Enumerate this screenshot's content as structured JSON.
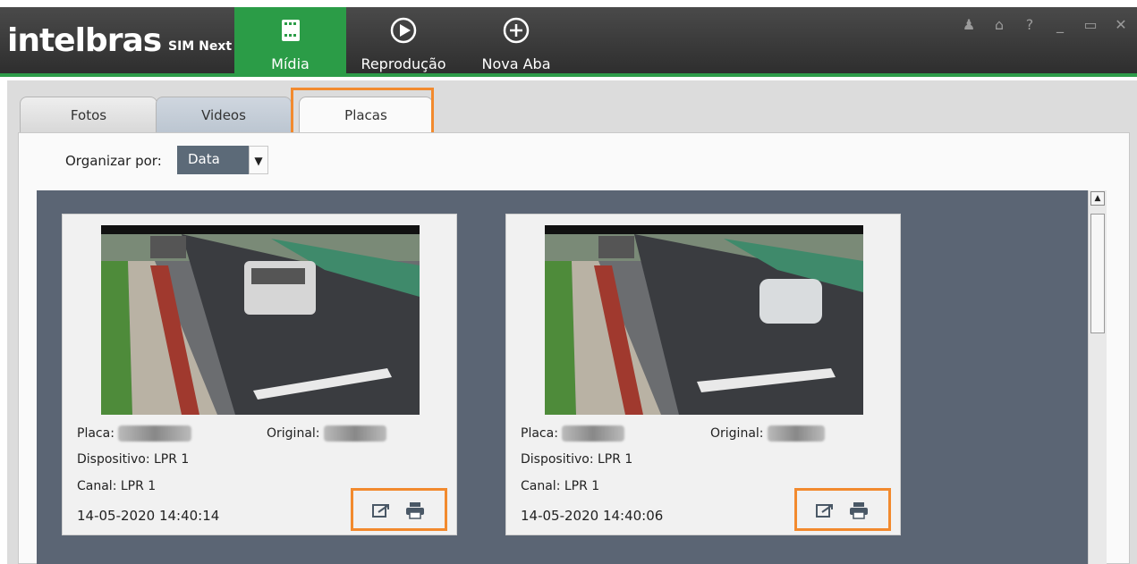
{
  "brand": {
    "name": "intelbras",
    "product": "SIM Next"
  },
  "nav": [
    {
      "label": "Mídia",
      "icon": "film-icon"
    },
    {
      "label": "Reprodução",
      "icon": "play-icon"
    },
    {
      "label": "Nova Aba",
      "icon": "plus-circle-icon"
    }
  ],
  "window_controls": [
    "user-icon",
    "lock-icon",
    "help-icon",
    "minimize-icon",
    "maximize-icon",
    "close-icon"
  ],
  "tabs": [
    {
      "label": "Fotos"
    },
    {
      "label": "Videos"
    },
    {
      "label": "Placas"
    }
  ],
  "organize": {
    "label": "Organizar por:",
    "value": "Data"
  },
  "cards": [
    {
      "plate_label": "Placa:",
      "original_label": "Original:",
      "device": "Dispositivo: LPR 1",
      "channel": "Canal: LPR 1",
      "datetime": "14-05-2020 14:40:14"
    },
    {
      "plate_label": "Placa:",
      "original_label": "Original:",
      "device": "Dispositivo: LPR 1",
      "channel": "Canal: LPR 1",
      "datetime": "14-05-2020 14:40:06"
    }
  ],
  "colors": {
    "accent": "#2b9c47",
    "highlight": "#f28a2e",
    "gallery_bg": "#5b6574"
  }
}
